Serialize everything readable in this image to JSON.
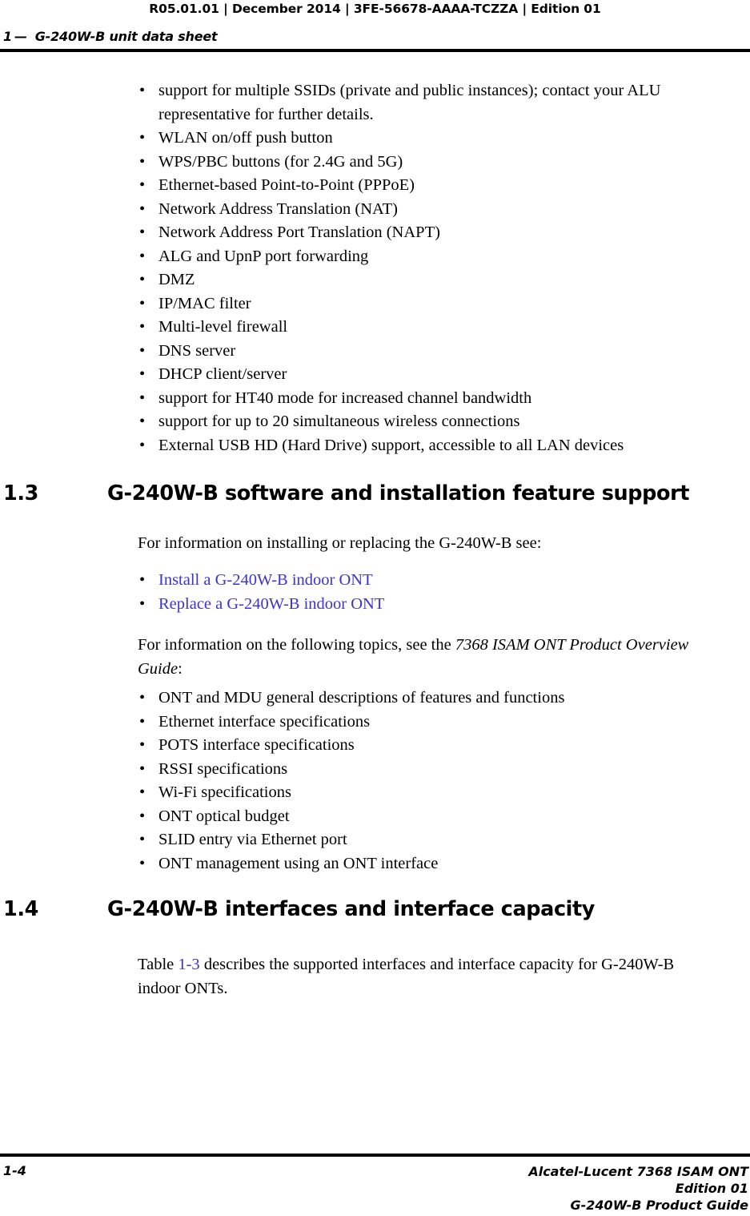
{
  "header": {
    "doc_info": "R05.01.01 | December 2014 | 3FE-56678-AAAA-TCZZA | Edition 01",
    "chapter_number": "1",
    "chapter_dash": "—",
    "chapter_title": "G-240W-B unit data sheet"
  },
  "feature_bullets": {
    "items": [
      "support for multiple SSIDs (private and public instances); contact your ALU representative for further details.",
      "WLAN on/off push button",
      "WPS/PBC buttons (for 2.4G and 5G)",
      "Ethernet-based Point-to-Point (PPPoE)",
      "Network Address Translation (NAT)",
      "Network Address Port Translation (NAPT)",
      "ALG and UpnP port forwarding",
      "DMZ",
      "IP/MAC filter",
      "Multi-level firewall",
      "DNS server",
      "DHCP client/server",
      "support for HT40 mode for increased channel bandwidth",
      "support for up to 20 simultaneous wireless connections",
      "External USB HD (Hard Drive) support, accessible to all LAN devices"
    ]
  },
  "section_1_3": {
    "number": "1.3",
    "title": "G-240W-B software and installation feature support",
    "intro_paragraph": "For information on installing or replacing the G-240W-B see:",
    "links": [
      "Install a G-240W-B indoor ONT",
      "Replace a G-240W-B indoor ONT"
    ],
    "topics_intro_prefix": "For information on the following topics, see the ",
    "topics_intro_italic": "7368 ISAM ONT Product Overview Guide",
    "topics_intro_suffix": ":",
    "topics": [
      "ONT and MDU general descriptions of features and functions",
      "Ethernet interface specifications",
      "POTS interface specifications",
      "RSSI specifications",
      "Wi-Fi specifications",
      "ONT optical budget",
      "SLID entry via Ethernet port",
      "ONT management using an ONT interface"
    ]
  },
  "section_1_4": {
    "number": "1.4",
    "title": "G-240W-B interfaces and interface capacity",
    "para_prefix": "Table ",
    "para_link": "1-3",
    "para_suffix": " describes the supported interfaces and interface capacity for G-240W-B indoor ONTs."
  },
  "footer": {
    "page_number": "1-4",
    "line1": "Alcatel-Lucent 7368 ISAM ONT",
    "line2": "Edition 01",
    "line3": "G-240W-B Product Guide"
  },
  "bullet_glyph": "•",
  "colors": {
    "link": "#3a34cc",
    "text": "#000000",
    "background": "#ffffff"
  }
}
